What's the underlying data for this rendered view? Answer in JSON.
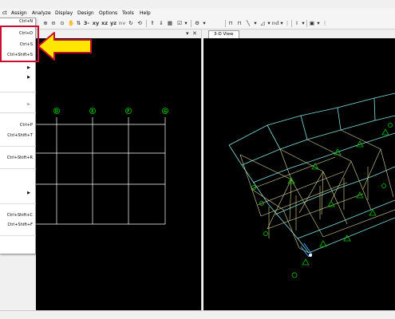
{
  "menubar": {
    "items": [
      "ct",
      "Assign",
      "Analyze",
      "Display",
      "Design",
      "Options",
      "Tools",
      "Help"
    ]
  },
  "toolbar": {
    "view_3d": "3-d",
    "view_xy": "xy",
    "view_xz": "xz",
    "view_yz": "yz",
    "view_nv": "nv",
    "nd_label": "nd"
  },
  "file_menu": {
    "shortcuts": [
      "Ctrl+N",
      "Ctrl+O",
      "Ctrl+S",
      "Ctrl+Shift+S",
      "Ctrl+P",
      "Ctrl+Shift+T",
      "Ctrl+Shift+R",
      "Ctrl+Shift+C",
      "Ctrl+Shift+F"
    ]
  },
  "plan_view": {
    "grid_labels": [
      "D",
      "E",
      "F",
      "G"
    ]
  },
  "view_3d": {
    "tab_label": "3-D View"
  },
  "colors": {
    "annotation_arrow_fill": "#ffe600",
    "annotation_outline": "#c8102e",
    "grid_color": "#ffffff",
    "bubble_color": "#00d000",
    "frame_color": "#d8d890",
    "roof_color": "#7fe0e0",
    "support_color": "#00c000"
  }
}
